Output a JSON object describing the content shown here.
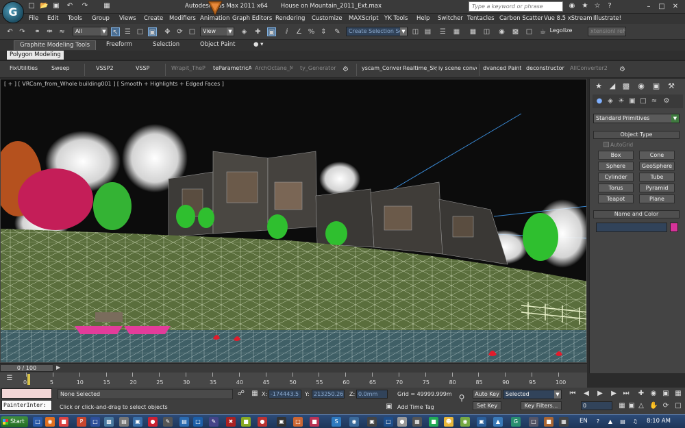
{
  "title": {
    "app": "Autodesk 3ds Max  2011 x64",
    "file": "House on Mountain_2011_Ext.max",
    "search_placeholder": "Type a keyword or phrase",
    "logo_letter": "G"
  },
  "menu": [
    "File",
    "Edit",
    "Tools",
    "Group",
    "Views",
    "Create",
    "Modifiers",
    "Animation",
    "Graph Editors",
    "Rendering",
    "Customize",
    "MAXScript",
    "YK Tools",
    "Help",
    "Switcher",
    "Tentacles",
    "Carbon Scatter",
    "Vue 8.5 xStream",
    "Illustrate!"
  ],
  "toolbar": {
    "selection_filter": "All",
    "ref_coord": "View",
    "named_selection": "Create Selection Se",
    "legolize": "Legolize",
    "extra_field": "xtensionl reFe"
  },
  "ribbon": {
    "tabs": [
      "Graphite Modeling Tools",
      "Freeform",
      "Selection",
      "Object Paint"
    ],
    "sub_tab": "Polygon Modeling"
  },
  "plugins": [
    "FixUtilities",
    "Sweep",
    "VSSP2",
    "VSSP",
    "Wrapit_TheP",
    "teParametricA",
    "ArchOctane_M",
    "ty_Generator",
    "yscam_Conver",
    "Realtime_Sky",
    "iy scene conve",
    "dvanced Paint",
    "deconstructor",
    "AllConverter2"
  ],
  "viewport": {
    "label": "[ + ] [ VRCam_from_Whole building001 ] [ Smooth + Highlights + Edged Faces ]"
  },
  "command_panel": {
    "category": "Standard Primitives",
    "object_type_header": "Object Type",
    "autogrid": "AutoGrid",
    "primitives": [
      "Box",
      "Cone",
      "Sphere",
      "GeoSphere",
      "Cylinder",
      "Tube",
      "Torus",
      "Pyramid",
      "Teapot",
      "Plane"
    ],
    "name_color_header": "Name and Color",
    "color": "#d63399"
  },
  "timeline": {
    "position": "0 / 100",
    "ticks": [
      "0",
      "5",
      "10",
      "15",
      "20",
      "25",
      "30",
      "35",
      "40",
      "45",
      "50",
      "55",
      "60",
      "65",
      "70",
      "75",
      "80",
      "85",
      "90",
      "95",
      "100"
    ]
  },
  "status": {
    "maxscript_output": "PainterInter:",
    "selection": "None Selected",
    "prompt": "Click or click-and-drag to select objects",
    "x_label": "X:",
    "x": "-174443.5",
    "y_label": "Y:",
    "y": "213250.26",
    "z_label": "Z:",
    "z": "0.0mm",
    "grid": "Grid = 49999.999m",
    "add_time_tag": "Add Time Tag",
    "auto_key": "Auto Key",
    "set_key": "Set Key",
    "key_selected": "Selected",
    "key_filters": "Key Filters...",
    "frame": "0"
  },
  "taskbar": {
    "start": "Start",
    "language": "EN",
    "time": "8:10 AM"
  }
}
